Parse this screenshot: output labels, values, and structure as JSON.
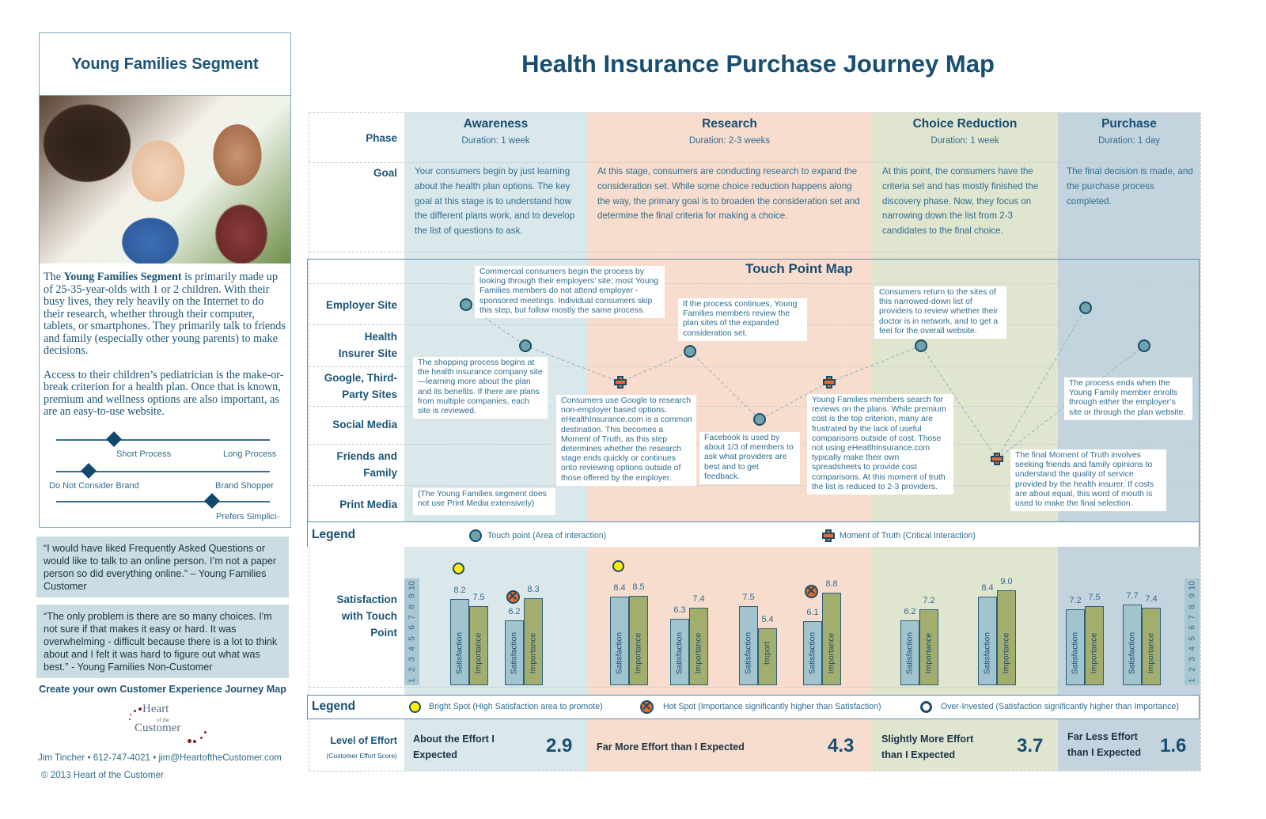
{
  "title": "Health Insurance Purchase Journey Map",
  "segment": {
    "title": "Young Families Segment",
    "photo_icon": "family-photo",
    "description_bold": "Young Families Segment",
    "description_pre": "The ",
    "description_post": " is primarily made up of 25-35-year-olds with 1 or 2 children. With their busy lives, they rely heavily on the Internet to do their research, whether through their computer, tablets, or smartphones.  They primarily talk to friends and family (especially other young parents) to make decisions.",
    "description_2": "Access to their children’s pediatrician is the make-or-break criterion for a health plan.  Once that is known, premium and wellness options are also important, as are an easy-to-use website.",
    "sliders": [
      {
        "left_label": "Short Process",
        "right_label": "Long Process",
        "position": 0.27
      },
      {
        "left_label": "Do Not Consider Brand",
        "right_label": "Brand Shopper",
        "position": 0.15
      },
      {
        "left_label": "",
        "right_label": "Prefers Simplici-",
        "position": 0.73
      }
    ]
  },
  "quotes": [
    "“I would have liked Frequently Asked Questions or would like to talk to an online person.  I’m not a paper person so did everything online.” – Young Families Customer",
    "“The only problem is there are so many choices. I'm not sure if that makes it easy or hard. It was overwhelming - difficult because there is a lot to think about and I felt it was hard to figure out what was best.” - Young Families Non-Customer"
  ],
  "create_link": "Create your own Customer Experience Journey Map",
  "logo": {
    "line1": "Heart",
    "line2": "of the",
    "line3": "Customer"
  },
  "contact": "Jim Tincher • 612-747-4021 • jim@HeartoftheCustomer.com",
  "copyright": "© 2013 Heart of the Customer",
  "row_labels": {
    "phase": "Phase",
    "goal": "Goal",
    "touchpoints": [
      "Employer Site",
      "Health Insurer Site",
      "Google, Third-Party Sites",
      "Social Media",
      "Friends and Family",
      "Print Media"
    ],
    "satisfaction": "Satisfaction with Touch Point",
    "effort": "Level of Effort",
    "effort_sub": "(Customer Effort Score)"
  },
  "phases": [
    {
      "name": "Awareness",
      "duration": "Duration: 1 week",
      "color": "#dae8ec",
      "goal": "Your consumers begin by just learning about the health plan options. The key goal at this stage is to understand how the different plans work, and to develop the list of questions to ask.",
      "effort_label": "About the Effort I Expected",
      "effort_score": "2.9"
    },
    {
      "name": "Research",
      "duration": "Duration: 2-3 weeks",
      "color": "#f8dccd",
      "goal": "At this stage, consumers are conducting research to expand the consideration set.  While some choice reduction happens along the way, the primary goal is to broaden the consideration set and determine the final criteria for making a choice.",
      "effort_label": "Far More Effort than I Expected",
      "effort_score": "4.3"
    },
    {
      "name": "Choice Reduction",
      "duration": "Duration: 1 week",
      "color": "#e0e5d0",
      "goal": "At this point, the consumers have the criteria set and has mostly finished the discovery phase.  Now, they focus on narrowing down the list from 2-3 candidates to the final choice.",
      "effort_label": "Slightly More Effort than I Expected",
      "effort_score": "3.7"
    },
    {
      "name": "Purchase",
      "duration": "Duration: 1 day",
      "color": "#c4d4de",
      "goal": "The final decision is made, and the purchase process completed.",
      "effort_label": "Far Less Effort than I Expected",
      "effort_score": "1.6"
    }
  ],
  "touchpoint_map": {
    "title": "Touch Point Map",
    "points": [
      {
        "type": "touchpoint",
        "row": "Employer Site"
      },
      {
        "type": "touchpoint",
        "row": "Health Insurer Site"
      },
      {
        "type": "moment-of-truth",
        "row": "Google, Third-Party Sites"
      },
      {
        "type": "touchpoint",
        "row": "Health Insurer Site"
      },
      {
        "type": "touchpoint",
        "row": "Social Media"
      },
      {
        "type": "moment-of-truth",
        "row": "Google, Third-Party Sites"
      },
      {
        "type": "touchpoint",
        "row": "Health Insurer Site"
      },
      {
        "type": "moment-of-truth",
        "row": "Friends and Family"
      },
      {
        "type": "touchpoint",
        "row": "Employer Site"
      },
      {
        "type": "touchpoint",
        "row": "Health Insurer Site"
      }
    ],
    "callouts": [
      "Commercial consumers begin the process by looking through their employers’ site; most Young Families members do not attend employer -sponsored meetings.  Individual consumers skip this step, but follow mostly the same process.",
      "The shopping process begins at the health insurance company site—learning more about the plan and its benefits.  If there are plans from multiple companies, each site is reviewed.",
      "Consumers use Google to research non-employer based options. eHealthInsurance.com is a common destination. This becomes a Moment of Truth, as this step determines whether the research stage ends quickly or continues onto reviewing options outside of those offered by the employer.",
      "If the process continues, Young Families members review the plan sites of the expanded consideration set.",
      "Facebook is used by about 1/3 of members to ask what providers are best and to get feedback.",
      "Young Families members search for reviews on the plans. While premium cost is the top criterion, many are frustrated by the lack of useful comparisons outside of cost.  Those not using eHeatlhInsurance.com typically make their own spreadsheets to provide cost comparisons. At this moment of truth the list is reduced to 2-3 providers.",
      "Consumers return to the sites of this narrowed-down list of providers to review whether their doctor is in network, and to get a feel for the overall website.",
      "The final Moment of Truth involves seeking friends and family opinions to understand the quality of service provided by the health insurer.  If costs are about equal, this word of mouth is used to make the final selection.",
      "The process ends when the Young Family member enrolls through either the employer’s site or through the plan website.",
      "(The Young Families segment does not use Print Media extensively)"
    ]
  },
  "legend1": {
    "title": "Legend",
    "items": [
      {
        "icon": "touchpoint-icon",
        "label": "Touch point (Area of interaction)"
      },
      {
        "icon": "moment-of-truth-icon",
        "label": "Moment of Truth (Critical Interaction)"
      }
    ]
  },
  "legend2": {
    "title": "Legend",
    "items": [
      {
        "icon": "bright-spot-icon",
        "label": "Bright Spot (High Satisfaction area to promote)"
      },
      {
        "icon": "hot-spot-icon",
        "label": "Hot Spot (Importance significantly higher than Satisfaction)"
      },
      {
        "icon": "over-invested-icon",
        "label": "Over-Invested (Satisfaction significantly higher than Importance)"
      }
    ]
  },
  "chart_data": {
    "type": "bar",
    "title": "Satisfaction with Touch Point",
    "ylim": [
      0,
      10
    ],
    "yticks": [
      "1",
      "2",
      "3",
      "4",
      "5",
      "6",
      "7",
      "8",
      "9",
      "10"
    ],
    "series_labels": {
      "satisfaction": "Satisfaction",
      "importance": "Importance",
      "importance_short": "Import"
    },
    "groups": [
      {
        "phase": "Awareness",
        "satisfaction": 8.2,
        "importance": 7.5,
        "marker": "bright-spot"
      },
      {
        "phase": "Awareness",
        "satisfaction": 6.2,
        "importance": 8.3,
        "marker": "hot-spot"
      },
      {
        "phase": "Research",
        "satisfaction": 8.4,
        "importance": 8.5,
        "marker": "bright-spot"
      },
      {
        "phase": "Research",
        "satisfaction": 6.3,
        "importance": 7.4,
        "marker": ""
      },
      {
        "phase": "Research",
        "satisfaction": 7.5,
        "importance": 5.4,
        "marker": ""
      },
      {
        "phase": "Research",
        "satisfaction": 6.1,
        "importance": 8.8,
        "marker": "hot-spot"
      },
      {
        "phase": "Choice Reduction",
        "satisfaction": 6.2,
        "importance": 7.2,
        "marker": ""
      },
      {
        "phase": "Choice Reduction",
        "satisfaction": 8.4,
        "importance": 9.0,
        "marker": ""
      },
      {
        "phase": "Purchase",
        "satisfaction": 7.2,
        "importance": 7.5,
        "marker": ""
      },
      {
        "phase": "Purchase",
        "satisfaction": 7.7,
        "importance": 7.4,
        "marker": ""
      }
    ],
    "value_labels": [
      [
        "8.2",
        "7.5"
      ],
      [
        "6.2",
        "8.3"
      ],
      [
        "8.4",
        "8.5"
      ],
      [
        "6.3",
        "7.4"
      ],
      [
        "7.5",
        "5.4"
      ],
      [
        "6.1",
        "8.8"
      ],
      [
        "6.2",
        "7.2"
      ],
      [
        "8.4",
        "9.0"
      ],
      [
        "7.2",
        "7.5"
      ],
      [
        "7.7",
        "7.4"
      ]
    ]
  }
}
